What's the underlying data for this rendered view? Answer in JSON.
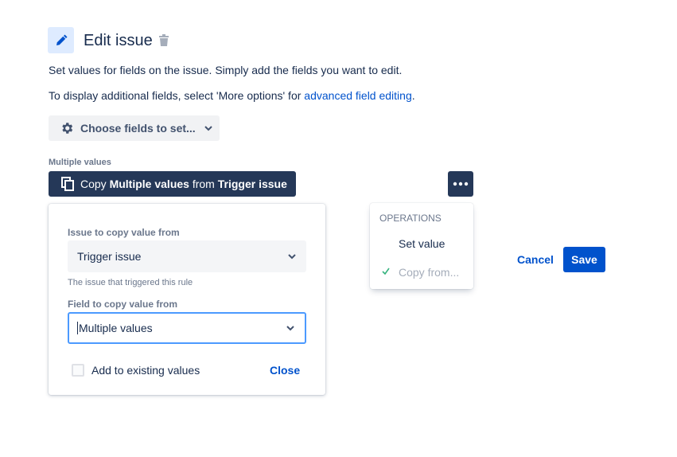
{
  "header": {
    "title": "Edit issue",
    "title_icon": "pencil-icon",
    "delete_icon": "trash-icon"
  },
  "description": {
    "line1": "Set values for fields on the issue. Simply add the fields you want to edit.",
    "line2_prefix": "To display additional fields, select 'More options' for ",
    "line2_link": "advanced field editing",
    "line2_suffix": "."
  },
  "choose_fields": {
    "label": "Choose fields to set...",
    "icon": "gear-icon"
  },
  "field": {
    "label": "Multiple values",
    "copy_button": {
      "prefix": "Copy ",
      "field_name": "Multiple values",
      "middle": " from ",
      "source": "Trigger issue"
    }
  },
  "panel": {
    "issue_label": "Issue to copy value from",
    "issue_value": "Trigger issue",
    "issue_helper": "The issue that triggered this rule",
    "field_label": "Field to copy value from",
    "field_value": "Multiple values",
    "add_existing_label": "Add to existing values",
    "add_existing_checked": false,
    "close_label": "Close"
  },
  "operations_menu": {
    "heading": "OPERATIONS",
    "items": [
      {
        "label": "Set value",
        "selected": false
      },
      {
        "label": "Copy from...",
        "selected": true
      }
    ]
  },
  "actions": {
    "cancel_label": "Cancel",
    "save_label": "Save"
  },
  "colors": {
    "primary": "#0052cc",
    "dark_button": "#253858",
    "check": "#36b37e"
  }
}
